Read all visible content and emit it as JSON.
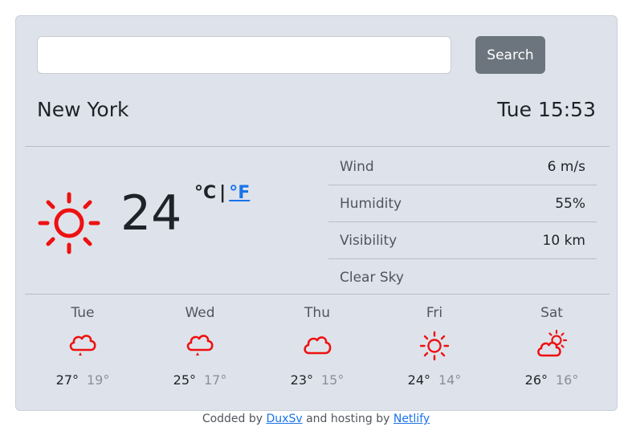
{
  "search": {
    "placeholder": "",
    "value": "",
    "button_label": "Search"
  },
  "location": {
    "city": "New York",
    "datetime": "Tue 15:53"
  },
  "current": {
    "temperature": "24",
    "icon": "sun-icon",
    "unit_c": "°C",
    "unit_separator": "|",
    "unit_f": "°F",
    "details": [
      {
        "label": "Wind",
        "value": "6 m/s"
      },
      {
        "label": "Humidity",
        "value": "55%"
      },
      {
        "label": "Visibility",
        "value": "10 km"
      },
      {
        "label": "Clear Sky",
        "value": ""
      }
    ]
  },
  "forecast": [
    {
      "day": "Tue",
      "icon": "cloud-drizzle-icon",
      "max": "27°",
      "min": "19°"
    },
    {
      "day": "Wed",
      "icon": "cloud-drizzle-icon",
      "max": "25°",
      "min": "17°"
    },
    {
      "day": "Thu",
      "icon": "cloud-icon",
      "max": "23°",
      "min": "15°"
    },
    {
      "day": "Fri",
      "icon": "sun-icon",
      "max": "24°",
      "min": "14°"
    },
    {
      "day": "Sat",
      "icon": "partly-cloudy-icon",
      "max": "26°",
      "min": "16°"
    }
  ],
  "footer": {
    "text1": "Codded by",
    "author": "DuxSv",
    "text2": "and hosting by",
    "host": "Netlify"
  },
  "colors": {
    "icon_red": "#ee1111",
    "link_blue": "#1a73e8",
    "card_bg": "#dee3eb",
    "button_gray": "#6c757d"
  }
}
